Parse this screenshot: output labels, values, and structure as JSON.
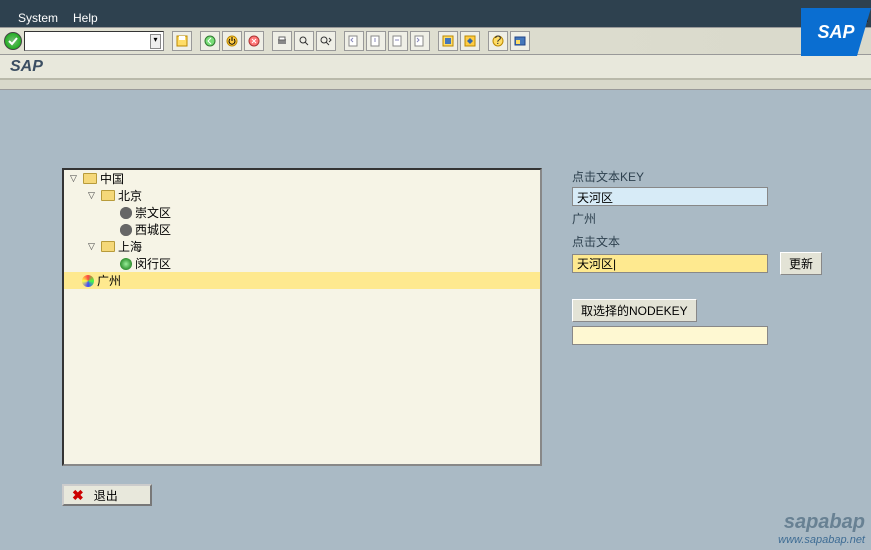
{
  "menu": {
    "system": "System",
    "help": "Help"
  },
  "app_title": "SAP",
  "cmdfield": {
    "value": ""
  },
  "tree": {
    "root": "中国",
    "n0": "北京",
    "n0_0": "崇文区",
    "n0_1": "西城区",
    "n1": "上海",
    "n1_0": "闵行区",
    "n2": "广州"
  },
  "side": {
    "key_label": "点击文本KEY",
    "key_value": "天河区",
    "parent_value": "广州",
    "text_label": "点击文本",
    "text_value": "天河区|",
    "update_btn": "更新",
    "getsel_btn": "取选择的NODEKEY",
    "result_value": ""
  },
  "exit_label": "退出",
  "watermark": {
    "main": "sapabap",
    "url": "www.sapabap.net"
  },
  "colors": {
    "accent": "#FEE98F",
    "bg": "#AABAC5"
  }
}
